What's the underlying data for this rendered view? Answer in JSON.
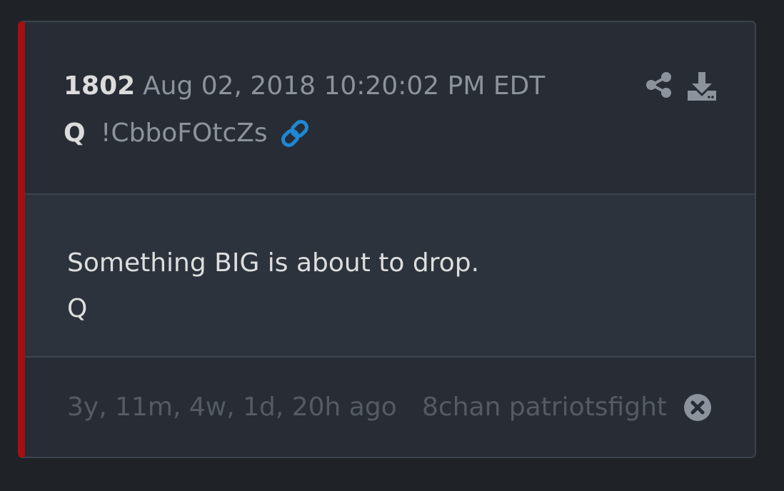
{
  "post": {
    "number": "1802",
    "date": "Aug 02, 2018 10:20:02 PM EDT",
    "author": "Q",
    "tripcode": "!CbboFOtcZs",
    "body_lines": [
      "Something BIG is about to drop.",
      "Q"
    ],
    "relative_time": "3y, 11m, 4w, 1d, 20h ago",
    "source": "8chan patriotsfight"
  },
  "icons": {
    "link": "link-icon",
    "share": "share-icon",
    "download": "download-icon",
    "close": "close-circle-icon"
  },
  "colors": {
    "accent_bar": "#a50f10",
    "link_blue": "#1e88d4",
    "card_bg": "#272c35",
    "body_bg": "#2c333d",
    "page_bg": "#1f2328"
  }
}
